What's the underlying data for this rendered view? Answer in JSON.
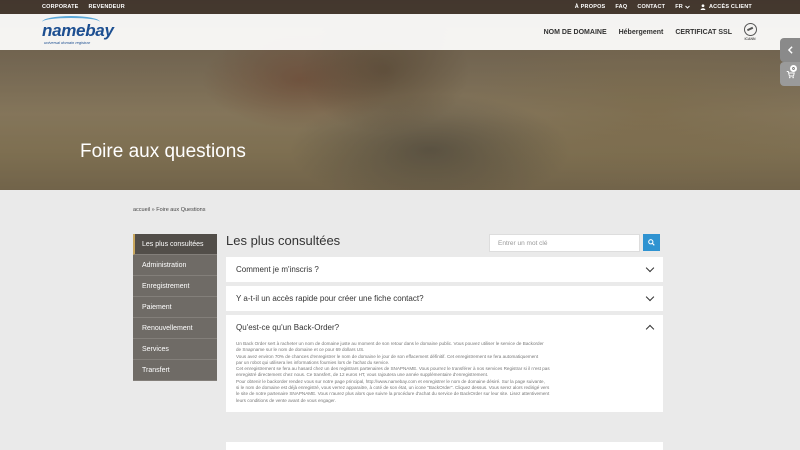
{
  "util_left": [
    "CORPORATE",
    "REVENDEUR"
  ],
  "util_right": {
    "about": "À PROPOS",
    "faq": "FAQ",
    "contact": "CONTACT",
    "lang": "FR",
    "client": "ACCÈS CLIENT"
  },
  "logo": {
    "name": "namebay",
    "tagline": "universal domain registrar"
  },
  "nav": [
    "NOM DE DOMAINE",
    "Hébergement",
    "CERTIFICAT SSL"
  ],
  "icann_label": "ICANN",
  "hero_title": "Foire aux questions",
  "cart_count": "0",
  "breadcrumb": "accueil » Foire aux Questions",
  "sidebar": [
    "Les plus consultées",
    "Administration",
    "Enregistrement",
    "Paiement",
    "Renouvellement",
    "Services",
    "Transfert"
  ],
  "section_title": "Les plus consultées",
  "search_placeholder": "Entrer un mot clé",
  "faq": [
    {
      "question": "Comment je m'inscris ?"
    },
    {
      "question": "Y a-t-il un accès rapide pour créer une fiche contact?"
    },
    {
      "question": "Qu'est-ce qu'un Back-Order?",
      "answer": [
        "Un Back Order sert à racheter un nom de domaine juste au moment de son retour dans le domaine public. Vous pouvez utiliser le service de Backorder",
        "de Snapname sur le nom de domaine et ce pour 69 dollars US.",
        "Vous avez environ 70% de chances d'enregistrer le nom de domaine le jour de son effacement définitif. Cet enregistrement se fera automatiquement",
        "par un robot qui utilisera les informations fournies lors de l'achat du service.",
        "Cet enregistrement se fera au hasard chez un des registrars partenaires de SNAPNAME. Vous pourrez le transférer à nos services Registrar si il n'est pas",
        "enregistré directement chez nous. Ce transfert, de 12 euros HT, vous rajoutera une année supplémentaire d'enregistrement.",
        "Pour obtenir le backorder rendez vous sur notre page principal, http://www.namebay.com et enregistrer le nom de domaine désiré. Sur la page suivante,",
        "si le nom de domaine est déjà enregistré, vous verrez apparaitre, à coté de son état, un icone \"BackOrder\". Cliquez dessus. Vous serez alors redirigé vers",
        "le site de notre partenaire SNAPNAME. Vous n'aurez plus alors que suivre la procédure d'achat du service de BackOrder sur leur site. Lisez attentivement",
        "leurs conditions de vente avant de vous engager."
      ]
    }
  ]
}
